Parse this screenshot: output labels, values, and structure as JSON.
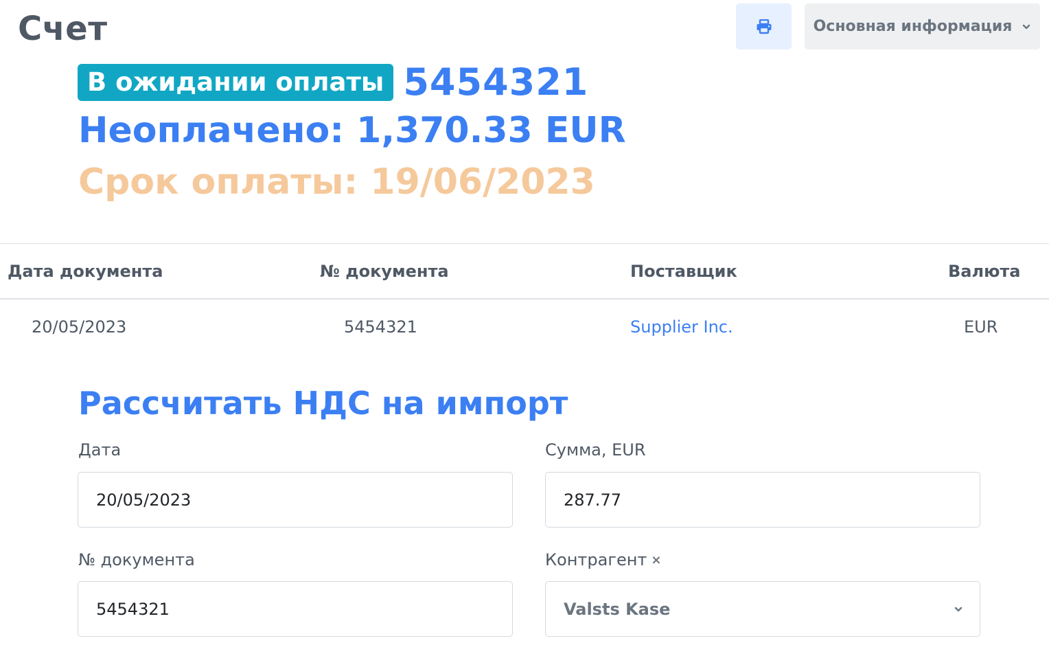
{
  "header": {
    "title": "Счет",
    "print_icon": "printer-icon",
    "info_dropdown_label": "Основная информация",
    "info_dropdown_icon": "chevron-down-icon"
  },
  "summary": {
    "status_badge": "В ожидании оплаты",
    "document_number": "5454321",
    "unpaid": "Неоплачено: 1,370.33 EUR",
    "due_date": "Срок оплаты: 19/06/2023"
  },
  "table": {
    "columns": [
      "Дата документа",
      "№ документа",
      "Поставщик",
      "Валюта"
    ],
    "row": {
      "date": "20/05/2023",
      "number": "5454321",
      "supplier": "Supplier Inc.",
      "currency": "EUR"
    }
  },
  "vat_form": {
    "title": "Рассчитать НДС на импорт",
    "date_label": "Дата",
    "date_value": "20/05/2023",
    "amount_label": "Сумма, EUR",
    "amount_value": "287.77",
    "docnum_label": "№ документа",
    "docnum_value": "5454321",
    "counterparty_label": "Контрагент",
    "counterparty_clear": "×",
    "counterparty_value": "Valsts Kase"
  },
  "colors": {
    "accent": "#3b7ff3",
    "badge": "#11a7c4",
    "due": "#f5c99b",
    "text": "#4f5965"
  }
}
